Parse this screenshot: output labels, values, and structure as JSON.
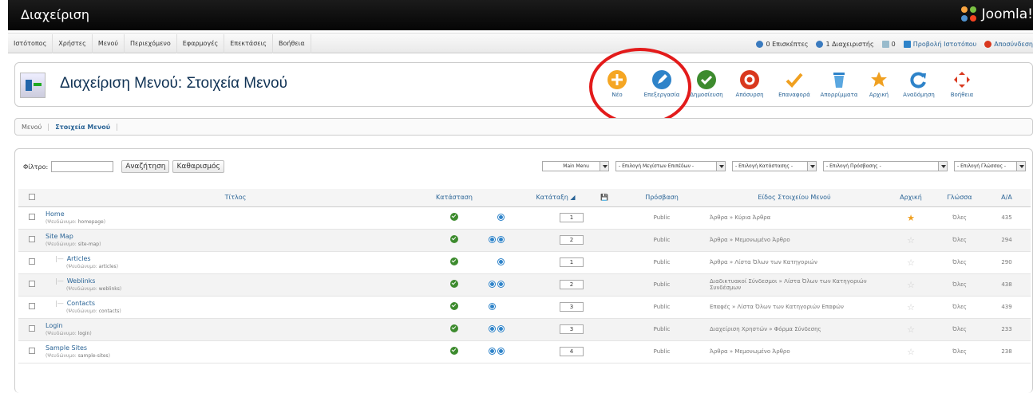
{
  "header": {
    "title": "Διαχείριση",
    "logo_text": "Joomla!"
  },
  "topbar": {
    "menu": [
      "Ιστότοπος",
      "Χρήστες",
      "Μενού",
      "Περιεχόμενο",
      "Εφαρμογές",
      "Επεκτάσεις",
      "Βοήθεια"
    ],
    "status": {
      "visitors": "0 Επισκέπτες",
      "admins": "1 Διαχειριστής",
      "messages": "0",
      "view_site": "Προβολή Ιστοτόπου",
      "logout": "Αποσύνδεση"
    }
  },
  "page_title": "Διαχείριση Μενού: Στοιχεία Μενού",
  "toolbar": [
    {
      "label": "Νέο",
      "icon": "new-icon",
      "color": "#f5a623"
    },
    {
      "label": "Επεξεργασία",
      "icon": "edit-icon",
      "color": "#2e83c9"
    },
    {
      "label": "Δημοσίευση",
      "icon": "publish-icon",
      "color": "#3d8b2e"
    },
    {
      "label": "Απόσυρση",
      "icon": "unpublish-icon",
      "color": "#d9381e"
    },
    {
      "label": "Επαναφορά",
      "icon": "checkin-icon",
      "color": "#f0a020"
    },
    {
      "label": "Απορρίμματα",
      "icon": "trash-icon",
      "color": "#2e83c9"
    },
    {
      "label": "Αρχική",
      "icon": "home-star-icon",
      "color": "#f0a020"
    },
    {
      "label": "Αναδόμηση",
      "icon": "rebuild-icon",
      "color": "#2e83c9"
    },
    {
      "label": "Βοήθεια",
      "icon": "help-icon",
      "color": "#d9381e"
    }
  ],
  "subnav": [
    "Μενού",
    "Στοιχεία Μενού"
  ],
  "filter": {
    "label": "Φίλτρο:",
    "value": "",
    "search_button": "Αναζήτηση",
    "clear_button": "Καθαρισμός",
    "selects": [
      "Main Menu",
      "- Επιλογή Μεγίστων Επιπέδων -",
      "- Επιλογή Κατάστασης -",
      "- Επιλογή Πρόσβασης -",
      "- Επιλογή Γλώσσας -"
    ]
  },
  "table": {
    "headers": [
      "Τίτλος",
      "Κατάσταση",
      "Κατάταξη",
      "Πρόσβαση",
      "Είδος Στοιχείου Μενού",
      "Αρχική",
      "Γλώσσα",
      "Α/Α"
    ],
    "alias_prefix": "(Ψευδώνυμο:",
    "rows": [
      {
        "title": "Home",
        "alias": "homepage",
        "level": 0,
        "order": "1",
        "up": false,
        "down": true,
        "access": "Public",
        "type": "Άρθρα » Κύρια Άρθρα",
        "home": true,
        "language": "Όλες",
        "id": "435"
      },
      {
        "title": "Site Map",
        "alias": "site-map",
        "level": 0,
        "order": "2",
        "up": true,
        "down": true,
        "access": "Public",
        "type": "Άρθρα » Μεμονωμένο Άρθρο",
        "home": false,
        "language": "Όλες",
        "id": "294"
      },
      {
        "title": "Articles",
        "alias": "articles",
        "level": 1,
        "order": "1",
        "up": false,
        "down": true,
        "access": "Public",
        "type": "Άρθρα » Λίστα Όλων των Κατηγοριών",
        "home": false,
        "language": "Όλες",
        "id": "290"
      },
      {
        "title": "Weblinks",
        "alias": "weblinks",
        "level": 1,
        "order": "2",
        "up": true,
        "down": true,
        "access": "Public",
        "type": "Διαδικτυακοί Σύνδεσμοι » Λίστα Όλων των Κατηγοριών Συνδέσμων",
        "home": false,
        "language": "Όλες",
        "id": "438"
      },
      {
        "title": "Contacts",
        "alias": "contacts",
        "level": 1,
        "order": "3",
        "up": true,
        "down": false,
        "access": "Public",
        "type": "Επαφές » Λίστα Όλων των Κατηγοριών Επαφών",
        "home": false,
        "language": "Όλες",
        "id": "439"
      },
      {
        "title": "Login",
        "alias": "login",
        "level": 0,
        "order": "3",
        "up": true,
        "down": true,
        "access": "Public",
        "type": "Διαχείριση Χρηστών » Φόρμα Σύνδεσης",
        "home": false,
        "language": "Όλες",
        "id": "233"
      },
      {
        "title": "Sample Sites",
        "alias": "sample-sites",
        "level": 0,
        "order": "4",
        "up": true,
        "down": true,
        "access": "Public",
        "type": "Άρθρα » Μεμονωμένο Άρθρο",
        "home": false,
        "language": "Όλες",
        "id": "238"
      }
    ]
  }
}
